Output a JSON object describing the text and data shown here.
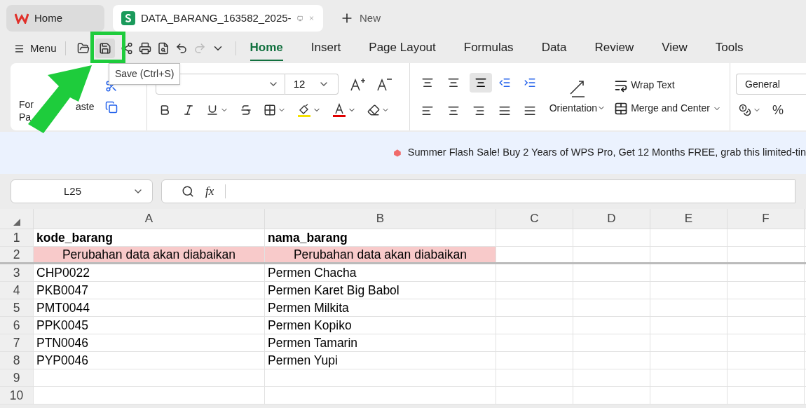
{
  "tabs": [
    {
      "label": "Home",
      "kind": "home",
      "selected": false
    },
    {
      "label": "DATA_BARANG_163582_2025-",
      "kind": "sheet",
      "selected": true
    },
    {
      "label": "New",
      "kind": "new",
      "selected": false
    }
  ],
  "menu_button": "Menu",
  "ribbon_tabs": [
    {
      "label": "Home",
      "selected": true
    },
    {
      "label": "Insert",
      "selected": false
    },
    {
      "label": "Page Layout",
      "selected": false
    },
    {
      "label": "Formulas",
      "selected": false
    },
    {
      "label": "Data",
      "selected": false
    },
    {
      "label": "Review",
      "selected": false
    },
    {
      "label": "View",
      "selected": false
    },
    {
      "label": "Tools",
      "selected": false
    }
  ],
  "tooltip": "Save (Ctrl+S)",
  "ribbon": {
    "format_painter": [
      "For",
      "Pa"
    ],
    "paste": "aste",
    "font_size": "12",
    "orientation": "Orientation",
    "wrap_text": "Wrap Text",
    "merge": "Merge and Center",
    "number_format": "General",
    "percent": "%"
  },
  "banner": "Summer Flash Sale! Buy 2 Years of WPS Pro, Get 12 Months FREE, grab this limited-tin",
  "name_box": "L25",
  "fx": "fx",
  "columns": [
    "A",
    "B",
    "C",
    "D",
    "E",
    "F"
  ],
  "rows": [
    {
      "number": "1",
      "kind": "header",
      "cells": [
        "kode_barang",
        "nama_barang"
      ]
    },
    {
      "number": "2",
      "kind": "note",
      "cells": [
        "Perubahan data akan diabaikan",
        "Perubahan data akan diabaikan"
      ]
    },
    {
      "number": "3",
      "kind": "data",
      "cells": [
        "CHP0022",
        "Permen Chacha"
      ]
    },
    {
      "number": "4",
      "kind": "data",
      "cells": [
        "PKB0047",
        "Permen Karet Big Babol"
      ]
    },
    {
      "number": "5",
      "kind": "data",
      "cells": [
        "PMT0044",
        "Permen Milkita"
      ]
    },
    {
      "number": "6",
      "kind": "data",
      "cells": [
        "PPK0045",
        "Permen Kopiko"
      ]
    },
    {
      "number": "7",
      "kind": "data",
      "cells": [
        "PTN0046",
        "Permen Tamarin"
      ]
    },
    {
      "number": "8",
      "kind": "data",
      "cells": [
        "PYP0046",
        "Permen Yupi"
      ]
    },
    {
      "number": "9",
      "kind": "data",
      "cells": []
    },
    {
      "number": "10",
      "kind": "data",
      "cells": []
    }
  ]
}
